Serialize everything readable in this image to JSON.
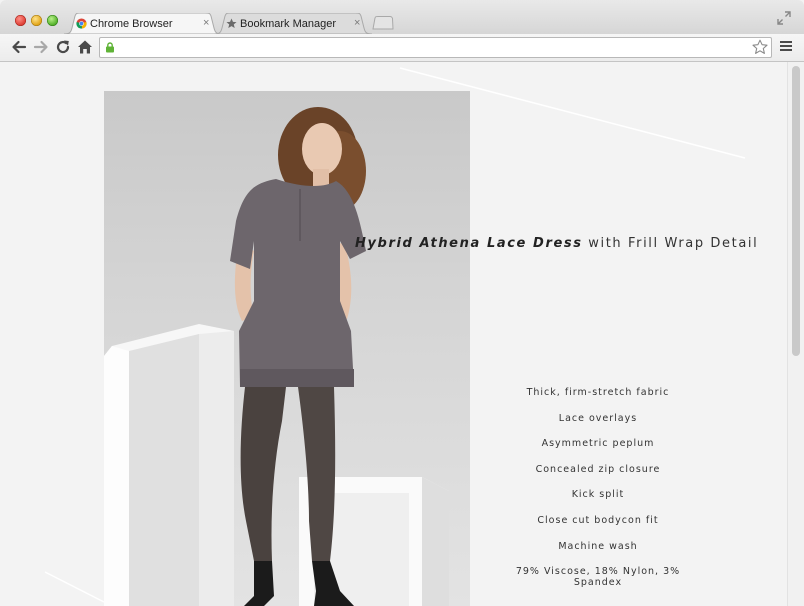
{
  "browser": {
    "tabs": [
      {
        "label": "Chrome Browser",
        "icon": "chrome-icon",
        "active": true
      },
      {
        "label": "Bookmark Manager",
        "icon": "star-icon",
        "active": false
      }
    ],
    "close_glyph": "×",
    "url": ""
  },
  "product": {
    "title_strong": "Hybrid Athena Lace Dress",
    "title_rest": " with Frill Wrap Detail",
    "features": [
      "Thick, firm-stretch fabric",
      "Lace overlays",
      "Asymmetric peplum",
      "Concealed zip closure",
      "Kick split",
      "Close cut bodycon fit",
      "Machine wash",
      "79% Viscose, 18% Nylon, 3% Spandex"
    ]
  },
  "colors": {
    "page_bg": "#f3f3f3",
    "lock_green": "#5fb336",
    "dress": "#6d666c"
  }
}
